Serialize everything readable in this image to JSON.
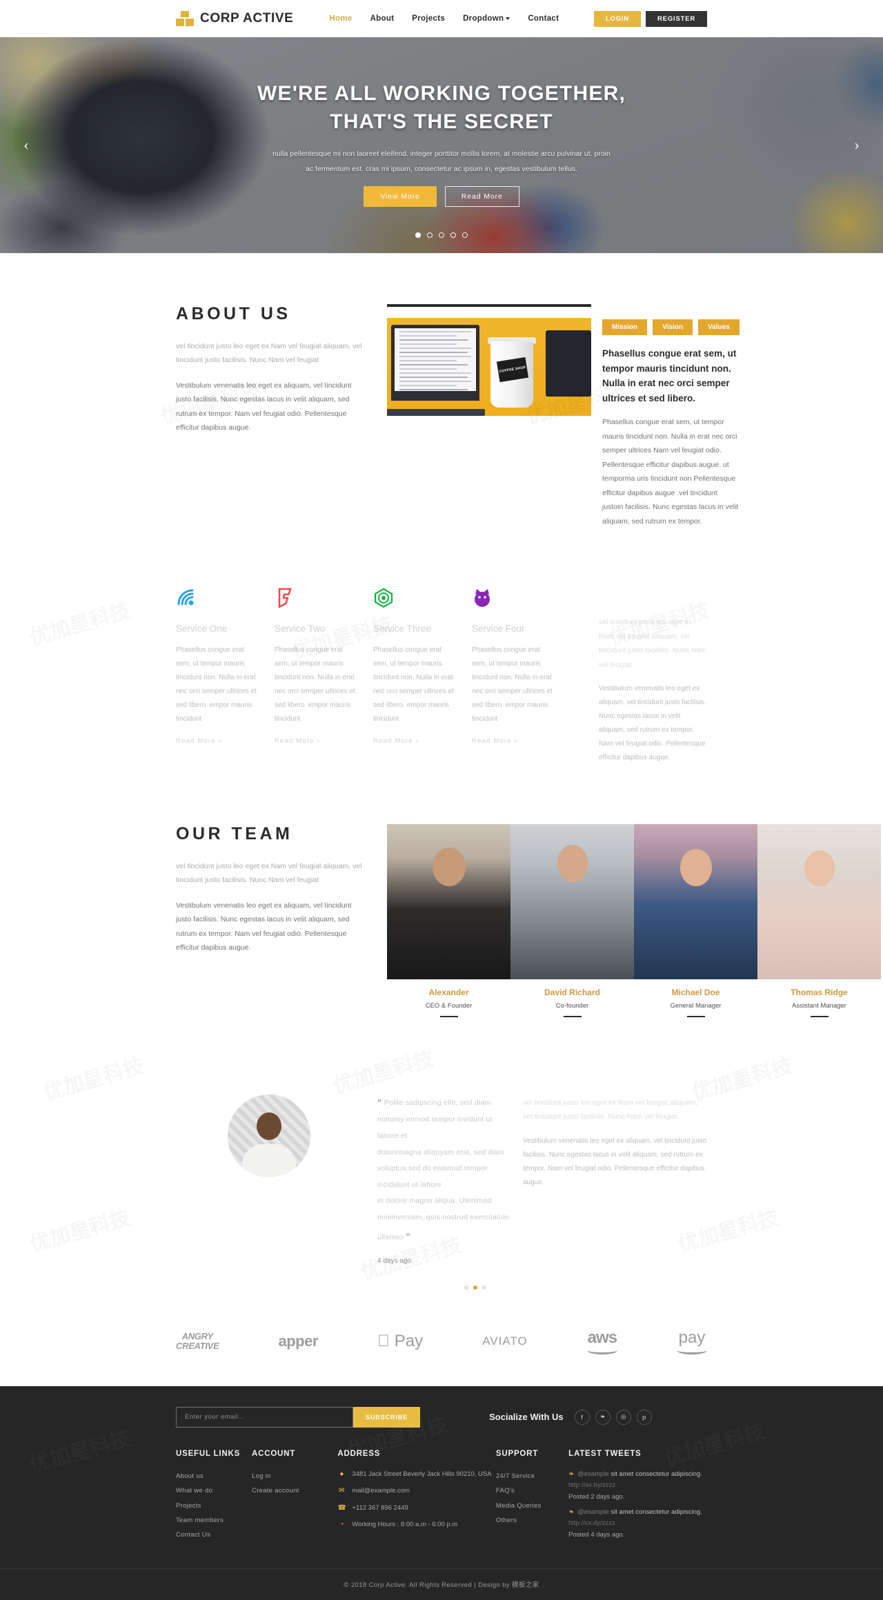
{
  "nav": {
    "brand": "CORP ACTIVE",
    "links": [
      {
        "label": "Home",
        "active": true
      },
      {
        "label": "About",
        "active": false
      },
      {
        "label": "Projects",
        "active": false
      },
      {
        "label": "Dropdown",
        "active": false,
        "caret": true
      },
      {
        "label": "Contact",
        "active": false
      }
    ],
    "login_label": "LOGIN",
    "register_label": "REGISTER"
  },
  "hero": {
    "title_line1": "WE'RE ALL WORKING TOGETHER,",
    "title_line2": "THAT'S THE SECRET",
    "subtitle_line1": "nulla pellentesque mi non laoreet eleifend. integer porttitor mollis lorem, at molestie arcu pulvinar ut. proin",
    "subtitle_line2": "ac fermentum est. cras mi ipsum, consectetur ac ipsum in, egestas vestibulum tellus.",
    "btn_primary": "View More",
    "btn_secondary": "Read More",
    "prev_arrow": "‹",
    "next_arrow": "›",
    "dots": 5,
    "active_dot": 0
  },
  "about": {
    "title": "ABOUT US",
    "p1": "vel tincidunt justo leo eget ex Nam vel feugiat aliquam, vel tincidunt justo facilisis. Nunc Nam vel feugiat",
    "p2": "Vestibulum venenatis leo eget ex aliquam, vel tincidunt justo facilisis. Nunc egestas lacus in velit aliquam, sed rutrum ex tempor. Nam vel feugiat odio. Pellentesque efficitur dapibus augue.",
    "image_badge": "COFFEE SHOP",
    "tabs": [
      "Mission",
      "Vision",
      "Values"
    ],
    "lead": "Phasellus congue erat sem, ut tempor mauris tincidunt non. Nulla in erat nec orci semper ultrices et sed libero.",
    "body": "Phasellus congue erat sem, ut tempor mauris tincidunt non. Nulla in erat nec orci semper ultrices Nam vel feugiat odio. Pellentesque efficitur dapibus augue. ut temporma uris tincidunt non Pellentesque efficitur dapibus augue .vel tincidunt justoin facilisis. Nunc egestas lacus in velit aliquam, sed rutrum ex tempor."
  },
  "services": {
    "items": [
      {
        "icon": "wifi-wave-icon",
        "title": "Service One",
        "text": "Phasellus congue erat sem, ut tempor mauris tincidunt non. Nulla in erat nec orci semper ultrices et sed libero. empor mauris tincidunt",
        "more": "Read More ›",
        "color": "#2aa3e0"
      },
      {
        "icon": "foursquare-icon",
        "title": "Service Two",
        "text": "Phasellus congue erat sem, ut tempor mauris tincidunt non. Nulla in erat nec orci semper ultrices et sed libero. empor mauris tincidunt",
        "more": "Read More ›",
        "color": "#f04a4a"
      },
      {
        "icon": "hexagon-badge-icon",
        "title": "Service Three",
        "text": "Phasellus congue erat sem, ut tempor mauris tincidunt non. Nulla in erat nec orci semper ultrices et sed libero. empor mauris tincidunt",
        "more": "Read More ›",
        "color": "#12b23f"
      },
      {
        "icon": "cat-face-icon",
        "title": "Service Four",
        "text": "Phasellus congue erat sem, ut tempor mauris tincidunt non. Nulla in erat nec orci semper ultrices et sed libero. empor mauris tincidunt",
        "more": "Read More ›",
        "color": "#8a26b5"
      }
    ],
    "side_p1": "vel tincidunt justo leo eget ex Nam vel feugiat aliquam, vel tincidunt justo facilisis. Nunc Nam vel feugiat",
    "side_p2": "Vestibulum venenatis leo eget ex aliquam, vel tincidunt justo facilisis. Nunc egestas lacus in velit aliquam, sed rutrum ex tempor. Nam vel feugiat odio. Pellentesque efficitur dapibus augue."
  },
  "team": {
    "title": "OUR TEAM",
    "p1": "vel tincidunt justo leo eget ex Nam vel feugiat aliquam, vel tincidunt justo facilisis. Nunc Nam vel feugiat",
    "p2": "Vestibulum venenatis leo eget ex aliquam, vel tincidunt justo facilisis. Nunc egestas lacus in velit aliquam, sed rutrum ex tempor. Nam vel feugiat odio. Pellentesque efficitur dapibus augue.",
    "members": [
      {
        "name": "Alexander",
        "role": "CEO & Founder"
      },
      {
        "name": "David Richard",
        "role": "Co-founder"
      },
      {
        "name": "Michael Doe",
        "role": "General Manager"
      },
      {
        "name": "Thomas Ridge",
        "role": "Assistant Manager"
      }
    ]
  },
  "testimonial": {
    "open_quote": "“",
    "close_quote": "”",
    "line1": "Polite sadipscing elitr, sed diam nonumy eirmod tempor invidunt ut labore et",
    "line2": "doloremagna aliquyam erat, sed diam voluptua.sed do eiusmod tempor incididunt ut labore",
    "line3": "et dolore magna aliqua. Utenimad minimveniam, quis nostrud exercitation ullamco",
    "ago": "4 days ago",
    "side_p1": "vel tincidunt justo leo eget ex Nam vel feugiat aliquam, vel tincidunt justo facilisis. Nunc Nam vel feugiat",
    "side_p2": "Vestibulum venenatis leo eget ex aliquam, vel tincidunt justo facilisis. Nunc egestas lacus in velit aliquam, sed rutrum ex tempor. Nam vel feugiat odio. Pellentesque efficitur dapibus augue.",
    "dots": 3,
    "active_dot": 1
  },
  "brands": [
    {
      "name": "angry-creative-logo",
      "line1": "ANGRY",
      "line2": "CREATIVE"
    },
    {
      "name": "apper-logo",
      "text": "apper"
    },
    {
      "name": "apple-pay-logo",
      "text": " Pay"
    },
    {
      "name": "aviato-logo",
      "text": "AVIATO"
    },
    {
      "name": "aws-logo",
      "text": "aws"
    },
    {
      "name": "amazon-pay-logo",
      "text": "pay"
    }
  ],
  "footer": {
    "newsletter_placeholder": "Enter your email...",
    "subscribe_label": "SUBSCRIBE",
    "socialize_label": "Socialize With Us",
    "social": [
      {
        "name": "facebook-icon",
        "glyph": "f"
      },
      {
        "name": "twitter-icon",
        "glyph": "❧"
      },
      {
        "name": "dribbble-icon",
        "glyph": "◎"
      },
      {
        "name": "pinterest-icon",
        "glyph": "p"
      }
    ],
    "useful_links": {
      "heading": "USEFUL LINKS",
      "items": [
        "About us",
        "What we do",
        "Projects",
        "Team members",
        "Contact Us"
      ]
    },
    "account": {
      "heading": "ACCOUNT",
      "items": [
        "Log in",
        "Create account"
      ]
    },
    "address": {
      "heading": "ADDRESS",
      "rows": [
        {
          "icon": "map-pin-icon",
          "glyph": "●",
          "text": "3481 Jack Street Beverly Jack Hills 90210, USA"
        },
        {
          "icon": "envelope-icon",
          "glyph": "✉",
          "text": "mail@example.com"
        },
        {
          "icon": "phone-icon",
          "glyph": "☎",
          "text": "+112 367 896 2449"
        },
        {
          "icon": "clock-icon",
          "glyph": "◔",
          "text": "Working Hours : 8:00 a.m - 6:00 p.m"
        }
      ]
    },
    "support": {
      "heading": "SUPPORT",
      "items": [
        "24/7 Service",
        "FAQ's",
        "Media Queries",
        "Others"
      ]
    },
    "tweets": {
      "heading": "LATEST TWEETS",
      "items": [
        {
          "handle": "@example",
          "text": "sit amet consectetur adipiscing.",
          "url": "http://ax.by/zzzz",
          "posted": "Posted 2 days ago."
        },
        {
          "handle": "@example",
          "text": "sit amet consectetur adipiscing.",
          "url": "http://cx.dy/zzzz",
          "posted": "Posted 4 days ago."
        }
      ]
    },
    "copyright": "© 2018 Corp Active. All Rights Reserved | Design by 模板之家"
  },
  "colors": {
    "accent": "#e3a72e",
    "gold": "#d9ab45",
    "dark": "#262626"
  }
}
